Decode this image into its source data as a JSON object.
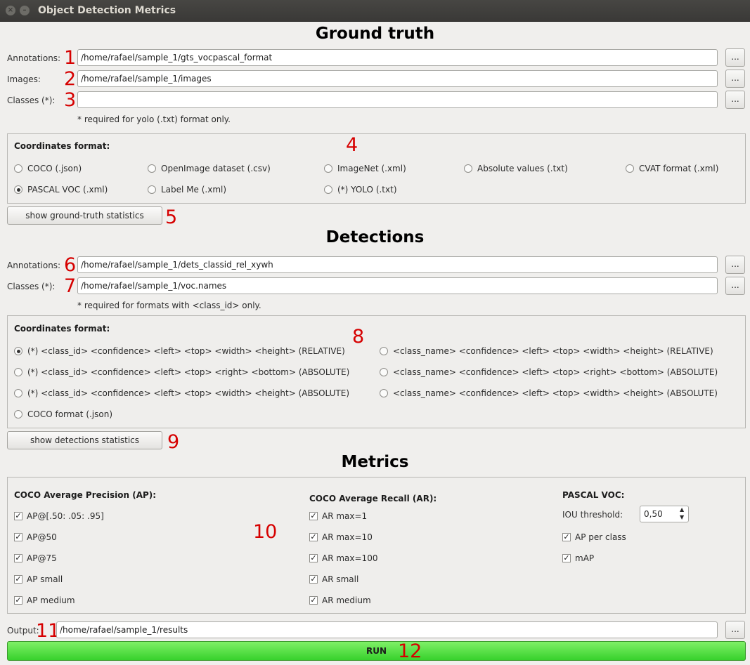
{
  "window": {
    "title": "Object Detection Metrics",
    "close_glyph": "×",
    "min_glyph": "–"
  },
  "ground_truth": {
    "heading": "Ground truth",
    "annotations_label": "Annotations:",
    "annotations_value": "/home/rafael/sample_1/gts_vocpascal_format",
    "images_label": "Images:",
    "images_value": "/home/rafael/sample_1/images",
    "classes_label": "Classes (*):",
    "classes_value": "",
    "note": "* required for yolo (.txt) format only.",
    "coords_title": "Coordinates format:",
    "formats": [
      "COCO (.json)",
      "OpenImage dataset (.csv)",
      "ImageNet (.xml)",
      "Absolute values (.txt)",
      "CVAT format (.xml)",
      "PASCAL VOC (.xml)",
      "Label Me (.xml)",
      "(*) YOLO (.txt)"
    ],
    "selected_format": "PASCAL VOC (.xml)",
    "stats_button": "show ground-truth statistics"
  },
  "detections": {
    "heading": "Detections",
    "annotations_label": "Annotations:",
    "annotations_value": "/home/rafael/sample_1/dets_classid_rel_xywh",
    "classes_label": "Classes (*):",
    "classes_value": "/home/rafael/sample_1/voc.names",
    "note": "* required for formats with <class_id> only.",
    "coords_title": "Coordinates format:",
    "formats": [
      "(*) <class_id> <confidence> <left> <top> <width> <height> (RELATIVE)",
      "<class_name> <confidence> <left> <top> <width> <height> (RELATIVE)",
      "(*) <class_id> <confidence> <left> <top> <right> <bottom> (ABSOLUTE)",
      "<class_name> <confidence> <left> <top> <right> <bottom> (ABSOLUTE)",
      "(*) <class_id> <confidence> <left> <top> <width> <height> (ABSOLUTE)",
      "<class_name> <confidence> <left> <top> <width> <height> (ABSOLUTE)",
      "COCO format (.json)"
    ],
    "selected_format": "(*) <class_id> <confidence> <left> <top> <width> <height> (RELATIVE)",
    "stats_button": "show detections statistics"
  },
  "metrics": {
    "heading": "Metrics",
    "coco_ap_title": "COCO Average Precision (AP):",
    "coco_ap": [
      "AP@[.50: .05: .95]",
      "AP@50",
      "AP@75",
      "AP small",
      "AP medium"
    ],
    "coco_ar_title": "COCO Average Recall (AR):",
    "coco_ar": [
      "AR max=1",
      "AR max=10",
      "AR max=100",
      "AR small",
      "AR medium"
    ],
    "voc_title": "PASCAL VOC:",
    "iou_label": "IOU threshold:",
    "iou_value": "0,50",
    "voc_checks": [
      "AP per class",
      "mAP"
    ]
  },
  "output": {
    "label": "Output:",
    "value": "/home/rafael/sample_1/results"
  },
  "browse_label": "...",
  "check_glyph": "✓",
  "run_label": "RUN",
  "markers": [
    "1",
    "2",
    "3",
    "4",
    "5",
    "6",
    "7",
    "8",
    "9",
    "10",
    "11",
    "12"
  ],
  "colors": {
    "marker": "#d60000",
    "run_green": "#37d12c"
  }
}
